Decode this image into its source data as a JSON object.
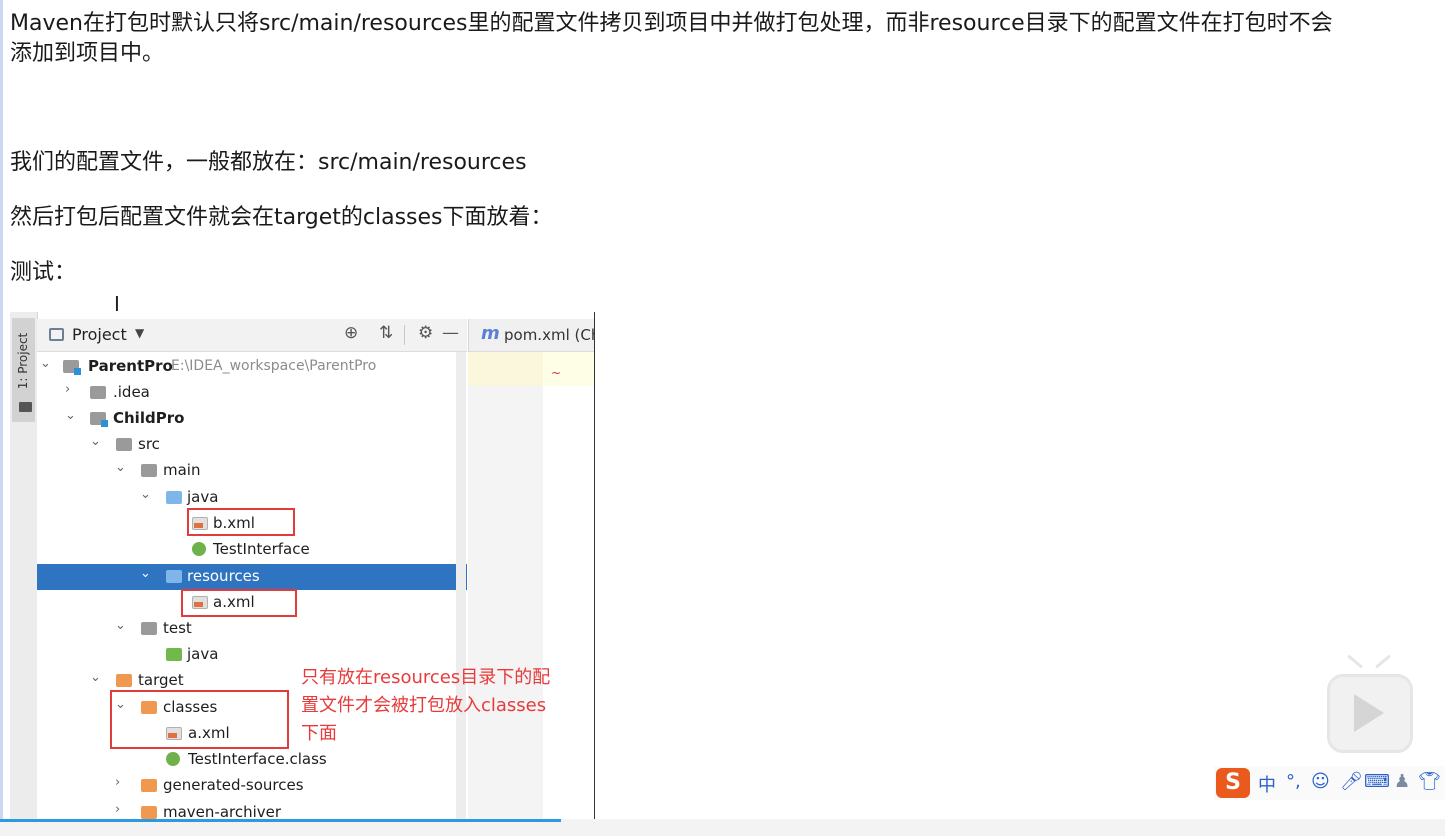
{
  "doc": {
    "para1_line1": "Maven在打包时默认只将src/main/resources里的配置文件拷贝到项目中并做打包处理，而非resource目录下的配置文件在打包时不会",
    "para1_line2": "添加到项目中。",
    "para2": "我们的配置文件，一般都放在：src/main/resources",
    "para3": "然后打包后配置文件就会在target的classes下面放着：",
    "para4": "测试："
  },
  "ide": {
    "side_tab_label": "1: Project",
    "panel_title": "Project",
    "editor_tab_label": "pom.xml (Ch",
    "tree": {
      "root_name": "ParentPro",
      "root_path": "E:\\IDEA_workspace\\ParentPro",
      "idea": ".idea",
      "child_module": "ChildPro",
      "src": "src",
      "main": "main",
      "java": "java",
      "b_xml": "b.xml",
      "test_interface": "TestInterface",
      "resources": "resources",
      "a_xml": "a.xml",
      "test": "test",
      "test_java": "java",
      "target": "target",
      "classes": "classes",
      "classes_a_xml": "a.xml",
      "test_interface_class": "TestInterface.class",
      "generated_sources": "generated-sources",
      "maven_archiver": "maven-archiver"
    }
  },
  "annotation": {
    "line1": "只有放在resources目录下的配",
    "line2": "置文件才会被打包放入classes",
    "line3": "下面"
  },
  "ime": {
    "logo": "S",
    "mode": "中",
    "punct": "°,"
  },
  "colors": {
    "selection": "#2e74c0",
    "highlight_box": "#e23b3b",
    "annotation_text": "#e83a3a",
    "ime_logo": "#ea5a1c",
    "progress": "#2b9ae0"
  }
}
